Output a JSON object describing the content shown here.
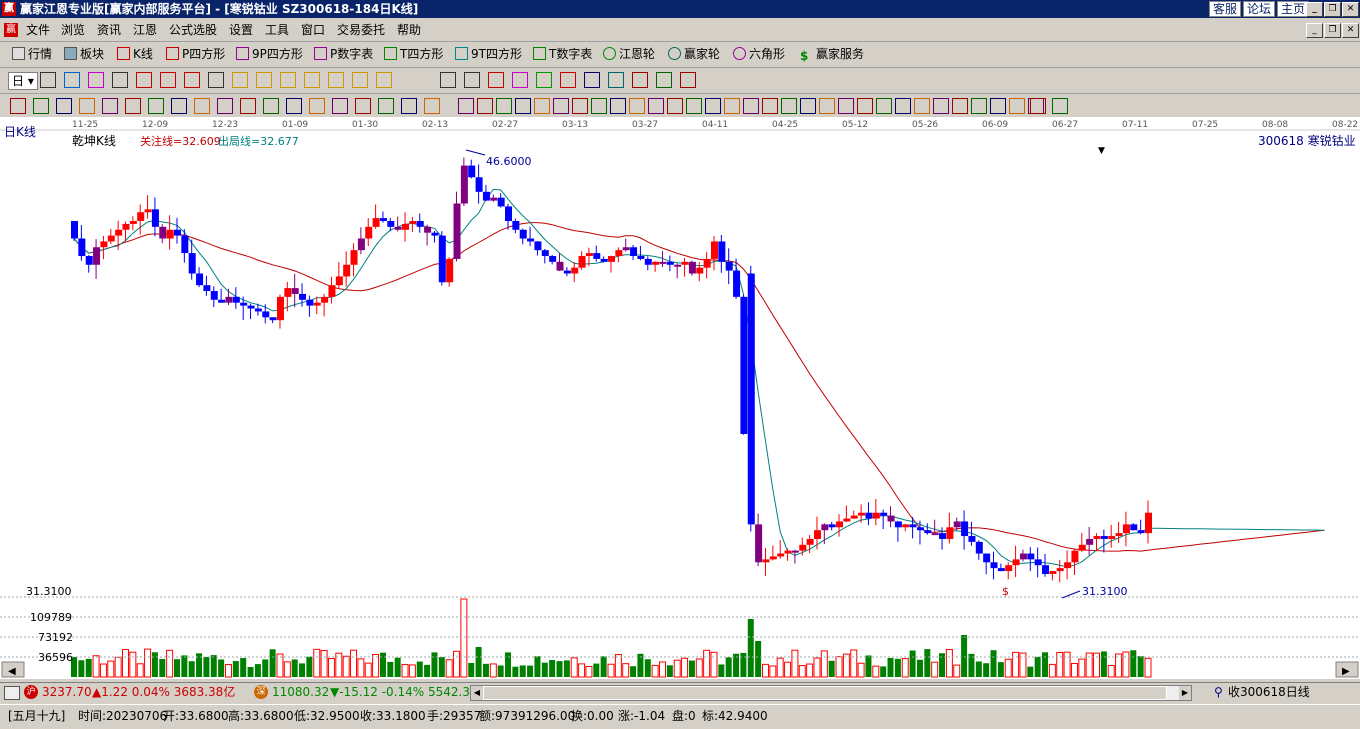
{
  "window": {
    "title": "赢家江恩专业版[赢家内部服务平台] - [寒锐钴业  SZ300618-184日K线]",
    "links": [
      "客服",
      "论坛",
      "主页"
    ]
  },
  "menu": [
    "文件",
    "浏览",
    "资讯",
    "江恩",
    "公式选股",
    "设置",
    "工具",
    "窗口",
    "交易委托",
    "帮助"
  ],
  "toolbar1": [
    "行情",
    "板块",
    "K线",
    "P四方形",
    "9P四方形",
    "P数字表",
    "T四方形",
    "9T四方形",
    "T数字表",
    "江恩轮",
    "赢家轮",
    "六角形",
    "赢家服务"
  ],
  "toolbar2": {
    "period": "日"
  },
  "chart": {
    "period_label": "日K线",
    "indicator_name": "乾坤K线",
    "attention_line": "关注线=32.609",
    "exit_line": "出局线=32.677",
    "stock": "300618  寒锐钴业",
    "high_label": "46.6000",
    "low_label": "31.3100",
    "left_price": "31.3100",
    "vol_labels": [
      "109789",
      "73192",
      "36596"
    ],
    "dollar": "$",
    "date_ticks": [
      "11-25",
      "12-09",
      "12-23",
      "01-09",
      "01-30",
      "02-13",
      "02-27",
      "03-13",
      "03-27",
      "04-11",
      "04-25",
      "05-12",
      "05-26",
      "06-09",
      "06-27",
      "07-11",
      "07-25",
      "08-08",
      "08-22"
    ],
    "colors": {
      "up": "#ff0000",
      "down": "#0000ff",
      "neutral": "#800080",
      "vol_up": "#ff0000",
      "vol_down": "#008000",
      "attention": "#c00000",
      "exit": "#008080"
    }
  },
  "status": {
    "sh_index": "3237.70",
    "sh_change": "▲1.22 0.04% 3683.38亿",
    "sz_index": "11080.32",
    "sz_change": "▼-15.12 -0.14% 5542.3",
    "fav": "收300618日线"
  },
  "info_bar": {
    "lunar": "[五月十九]",
    "time": "时间:20230706",
    "open": "开:33.6800",
    "high": "高:33.6800",
    "low": "低:32.9500",
    "close": "收:33.1800",
    "hand": "手:29357",
    "amount": "额:97391296.00",
    "turnover": "换:0.00",
    "change": "涨:-1.04",
    "pan": "盘:0",
    "mark": "标:42.9400"
  },
  "chart_data": {
    "type": "candlestick",
    "title": "寒锐钴业 300618 日K线",
    "xlabel": "",
    "ylabel": "",
    "ylim": [
      31.31,
      46.6
    ],
    "note_markers": {
      "high": 46.6,
      "low": 31.31
    },
    "x_ticks": [
      "11-25",
      "12-09",
      "12-23",
      "01-09",
      "01-30",
      "02-13",
      "02-27",
      "03-13",
      "03-27",
      "04-11",
      "04-25",
      "05-12",
      "05-26",
      "06-09",
      "06-27",
      "07-11",
      "07-25",
      "08-08",
      "08-22"
    ],
    "close": [
      43.6,
      43.0,
      42.7,
      43.3,
      43.5,
      43.7,
      43.9,
      44.1,
      44.2,
      44.5,
      44.6,
      44.0,
      43.6,
      43.9,
      43.7,
      43.1,
      42.4,
      42.0,
      41.8,
      41.5,
      41.4,
      41.6,
      41.4,
      41.3,
      41.2,
      41.1,
      40.9,
      40.8,
      41.6,
      41.9,
      41.7,
      41.5,
      41.3,
      41.4,
      41.6,
      42.0,
      42.3,
      42.7,
      43.2,
      43.6,
      44.0,
      44.3,
      44.2,
      44.0,
      43.9,
      44.1,
      44.2,
      44.0,
      43.8,
      43.7,
      42.1,
      42.9,
      44.8,
      46.1,
      45.7,
      45.2,
      44.9,
      45.0,
      44.7,
      44.2,
      43.9,
      43.6,
      43.5,
      43.2,
      43.0,
      42.8,
      42.5,
      42.4,
      42.6,
      43.0,
      43.1,
      42.9,
      42.8,
      43.0,
      43.2,
      43.3,
      43.0,
      42.9,
      42.7,
      42.8,
      42.8,
      42.7,
      42.7,
      42.8,
      42.4,
      42.6,
      42.9,
      43.5,
      42.8,
      42.5,
      41.6,
      36.9,
      33.8,
      32.5,
      32.6,
      32.7,
      32.8,
      32.9,
      32.9,
      33.1,
      33.3,
      33.6,
      33.8,
      33.7,
      33.9,
      34.0,
      34.1,
      34.2,
      34.0,
      34.2,
      34.1,
      33.9,
      33.7,
      33.8,
      33.7,
      33.6,
      33.5,
      33.5,
      33.3,
      33.7,
      33.9,
      33.4,
      33.2,
      32.8,
      32.5,
      32.3,
      32.2,
      32.4,
      32.6,
      32.8,
      32.6,
      32.4,
      32.1,
      32.2,
      32.3,
      32.5,
      32.9,
      33.1,
      33.3,
      33.4,
      33.3,
      33.4,
      33.5,
      33.8,
      33.6,
      33.5,
      34.2
    ]
  }
}
